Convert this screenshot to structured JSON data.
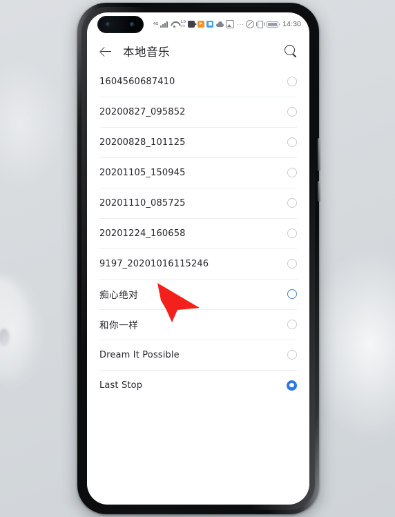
{
  "device": {
    "type": "smartphone",
    "background_color": "#d8dcdf",
    "frame_color": "#0c0d0e",
    "screen_background": "#ffffff"
  },
  "status_bar": {
    "network_type": "4G",
    "signal_icon": "signal-bars-icon",
    "wifi_icon": "wifi-icon",
    "network_speed_value": "1.0",
    "network_speed_unit": "K/s",
    "notification_icons": [
      "video-recorder-icon",
      "orange-media-player-icon",
      "blue-app-icon",
      "cloud-icon",
      "gallery-image-icon",
      "more-notifications-icon"
    ],
    "more_dots": "···",
    "alarm_icon": "alarm-off-icon",
    "vibrate_icon": "vibrate-mode-icon",
    "battery_icon": "battery-full-icon",
    "clock": "14:30"
  },
  "app_bar": {
    "back_icon": "back-arrow-icon",
    "title": "本地音乐",
    "search_icon": "search-icon"
  },
  "list": {
    "selection_mode": "single-select-radio",
    "accent_color": "#2979e6",
    "hover_color": "#3f86c8",
    "items": [
      {
        "label": "1604560687410",
        "state": "unselected",
        "cjk": false
      },
      {
        "label": "20200827_095852",
        "state": "unselected",
        "cjk": false
      },
      {
        "label": "20200828_101125",
        "state": "unselected",
        "cjk": false
      },
      {
        "label": "20201105_150945",
        "state": "unselected",
        "cjk": false
      },
      {
        "label": "20201110_085725",
        "state": "unselected",
        "cjk": false
      },
      {
        "label": "20201224_160658",
        "state": "unselected",
        "cjk": false
      },
      {
        "label": "9197_20201016115246",
        "state": "unselected",
        "cjk": false
      },
      {
        "label": "痴心绝对",
        "state": "hover",
        "cjk": true
      },
      {
        "label": "和你一样",
        "state": "unselected",
        "cjk": true
      },
      {
        "label": "Dream It Possible",
        "state": "unselected",
        "cjk": false
      },
      {
        "label": "Last Stop",
        "state": "selected",
        "cjk": false
      }
    ]
  },
  "cursor": {
    "icon": "mouse-pointer-arrow",
    "color": "#f3201c",
    "points_at": "痴心绝对"
  }
}
